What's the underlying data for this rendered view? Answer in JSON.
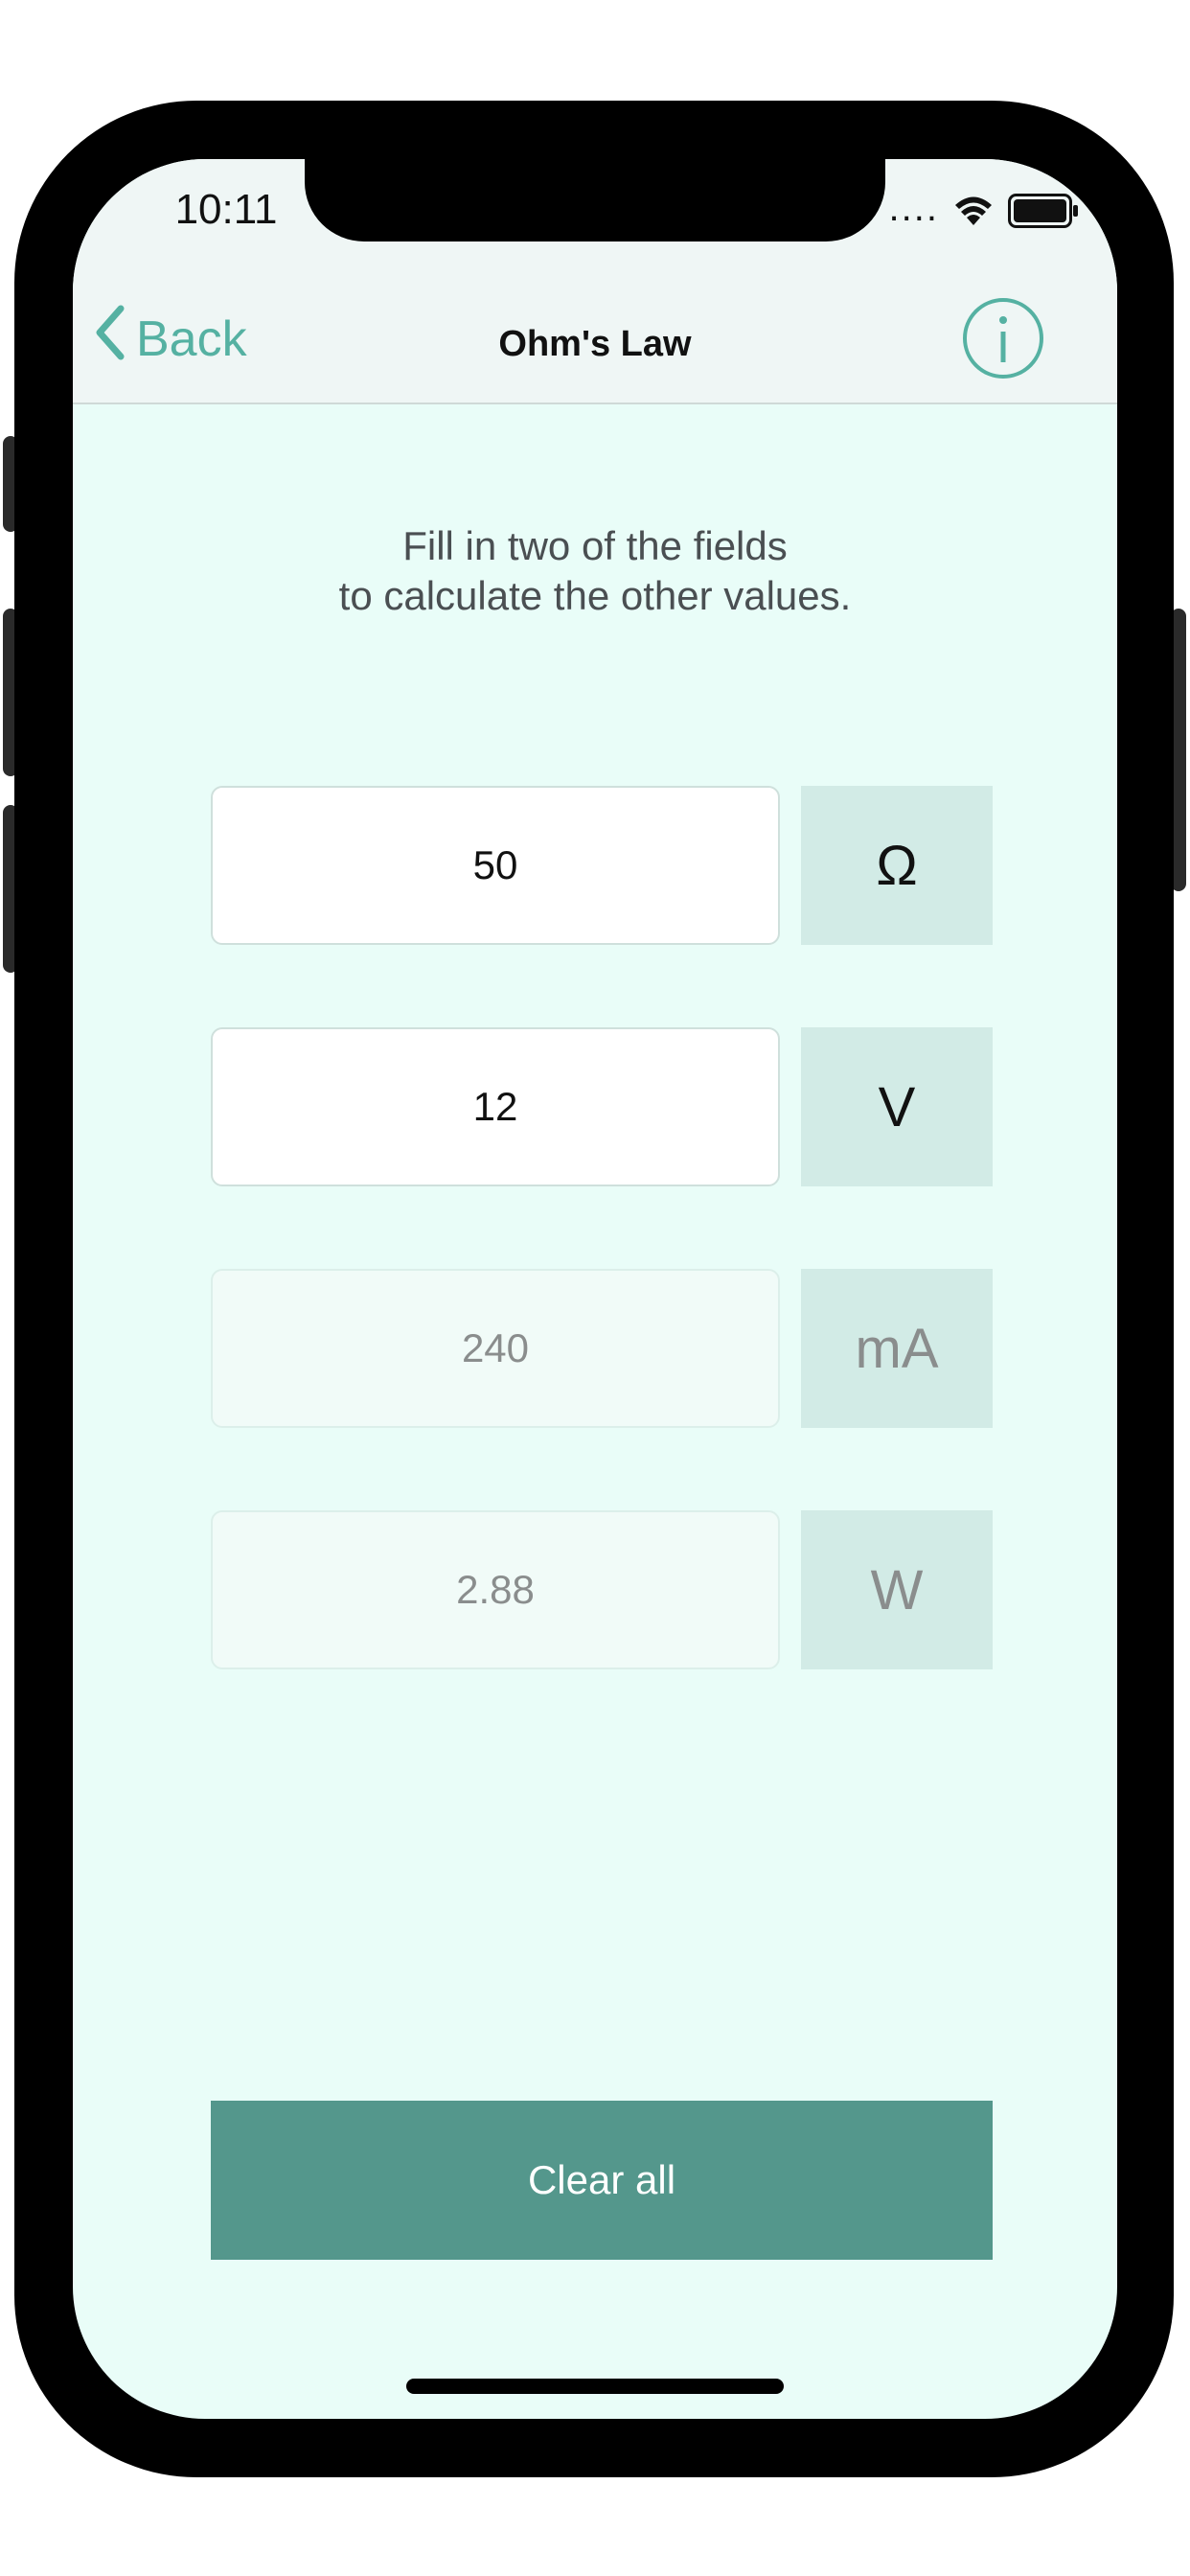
{
  "status_bar": {
    "time": "10:11",
    "signal_dots": "...."
  },
  "nav": {
    "back_label": "Back",
    "title": "Ohm's Law"
  },
  "instructions": {
    "line1": "Fill in two of the fields",
    "line2": "to calculate the other values."
  },
  "fields": [
    {
      "value": "50",
      "unit": "Ω"
    },
    {
      "value": "12",
      "unit": "V"
    },
    {
      "value": "240",
      "unit": "mA"
    },
    {
      "value": "2.88",
      "unit": "W"
    }
  ],
  "clear_button": {
    "label": "Clear all"
  },
  "colors": {
    "accent": "#55b1a2",
    "button": "#54978c",
    "background": "#e9fdf8",
    "unit_box": "#d2ebe6"
  }
}
